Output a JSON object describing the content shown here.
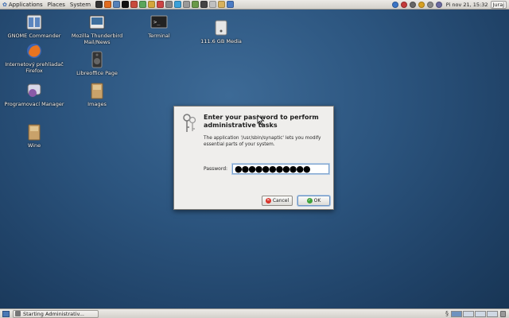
{
  "top_panel": {
    "menus": [
      "Applications",
      "Places",
      "System"
    ],
    "launchers": [
      {
        "icon": "terminal-launcher-icon",
        "color": "#333333"
      },
      {
        "icon": "firefox-launcher-icon",
        "color": "#e06b1e"
      },
      {
        "icon": "mail-launcher-icon",
        "color": "#5580b8"
      },
      {
        "icon": "music-launcher-icon",
        "color": "#111111"
      },
      {
        "icon": "photos-launcher-icon",
        "color": "#c84a3c"
      },
      {
        "icon": "chat-launcher-icon",
        "color": "#5aa65a"
      },
      {
        "icon": "game-launcher-icon",
        "color": "#d4a63a"
      },
      {
        "icon": "editor-launcher-icon",
        "color": "#cc4444"
      },
      {
        "icon": "search-launcher-icon",
        "color": "#888888"
      },
      {
        "icon": "skype-launcher-icon",
        "color": "#3aa0d8"
      },
      {
        "icon": "calc-launcher-icon",
        "color": "#999999"
      },
      {
        "icon": "image-launcher-icon",
        "color": "#6a9a48"
      },
      {
        "icon": "monitor-launcher-icon",
        "color": "#444444"
      },
      {
        "icon": "mail2-launcher-icon",
        "color": "#c0c0c0"
      },
      {
        "icon": "files-launcher-icon",
        "color": "#d8b15c"
      },
      {
        "icon": "network-launcher-icon",
        "color": "#4b7bc4"
      }
    ],
    "tray_colors": [
      "#3a74c6",
      "#c43b3b",
      "#666666",
      "#d8a020",
      "#888888",
      "#6a6aa0"
    ],
    "clock": "Pi nov 21, 15:32",
    "user": "Juraj"
  },
  "desktop_icons": [
    {
      "label": "GNOME Commander"
    },
    {
      "label": "Mozilla Thunderbird Mail/News"
    },
    {
      "label": "Terminal"
    },
    {
      "label": "111.6 GB Media"
    },
    {
      "label": "Internetový prehliadač Firefox"
    },
    {
      "label": "Libreoffice Page"
    },
    {
      "label": "Programovací Manager"
    },
    {
      "label": "Images"
    },
    {
      "label": "Wine"
    }
  ],
  "dialog": {
    "title": "Enter your password to perform administrative tasks",
    "message": "The application '/usr/sbin/synaptic' lets you modify essential parts of your system.",
    "password_label": "Password:",
    "password_value": "●●●●●●●●●●●",
    "cancel_label": "Cancel",
    "ok_label": "OK"
  },
  "bottom_panel": {
    "task_label": "Starting Administrativ...",
    "workspaces": 4
  }
}
